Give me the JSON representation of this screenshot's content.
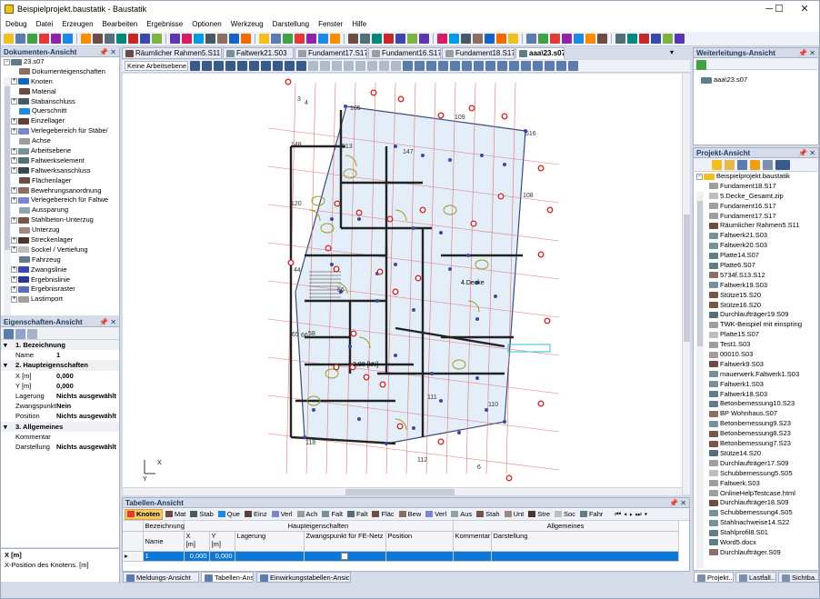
{
  "window": {
    "title": "Beispielprojekt.baustatik - Baustatik",
    "controls": [
      "─",
      "☐",
      "✕"
    ]
  },
  "menu": [
    "Debug",
    "Datei",
    "Erzeugen",
    "Bearbeiten",
    "Ergebnisse",
    "Optionen",
    "Werkzeug",
    "Darstellung",
    "Fenster",
    "Hilfe"
  ],
  "doc_panel": {
    "title": "Dokumenten-Ansicht",
    "root": "23.s07",
    "items": [
      {
        "label": "Dokumenteigenschaften",
        "expand": false,
        "color": "#8d6e63"
      },
      {
        "label": "Knoten",
        "expand": true,
        "color": "#1565c0"
      },
      {
        "label": "Material",
        "expand": false,
        "color": "#6d4c41"
      },
      {
        "label": "Stabanschluss",
        "expand": true,
        "color": "#455a64"
      },
      {
        "label": "Querschnitt",
        "expand": false,
        "color": "#1e88e5"
      },
      {
        "label": "Einzellager",
        "expand": true,
        "color": "#5d4037"
      },
      {
        "label": "Verlegebereich für Stäbe/",
        "expand": true,
        "color": "#7986cb"
      },
      {
        "label": "Achse",
        "expand": false,
        "color": "#9e9e9e"
      },
      {
        "label": "Arbeitsebene",
        "expand": true,
        "color": "#78909c"
      },
      {
        "label": "Faltwerkselement",
        "expand": true,
        "color": "#546e7a"
      },
      {
        "label": "Faltwerksanschluss",
        "expand": true,
        "color": "#37474f"
      },
      {
        "label": "Flächenlager",
        "expand": false,
        "color": "#6d4c41"
      },
      {
        "label": "Bewehrungsanordnung",
        "expand": true,
        "color": "#8d6e63"
      },
      {
        "label": "Verlegebereich für Faltwe",
        "expand": true,
        "color": "#7986cb"
      },
      {
        "label": "Aussparung",
        "expand": false,
        "color": "#90a4ae"
      },
      {
        "label": "Stahlbeton-Unterzug",
        "expand": true,
        "color": "#795548"
      },
      {
        "label": "Unterzug",
        "expand": false,
        "color": "#a1887f"
      },
      {
        "label": "Streckenlager",
        "expand": true,
        "color": "#4e342e"
      },
      {
        "label": "Sockel / Vertiefung",
        "expand": true,
        "color": "#bdbdbd"
      },
      {
        "label": "Fahrzeug",
        "expand": false,
        "color": "#607d8b"
      },
      {
        "label": "Zwangslinie",
        "expand": true,
        "color": "#3949ab"
      },
      {
        "label": "Ergebnislinie",
        "expand": true,
        "color": "#283593"
      },
      {
        "label": "Ergebnisraster",
        "expand": true,
        "color": "#5c6bc0"
      },
      {
        "label": "Lastimport",
        "expand": true,
        "color": "#9e9e9e"
      }
    ]
  },
  "props_panel": {
    "title": "Eigenschaften-Ansicht",
    "rows": [
      {
        "type": "cat",
        "k": "1. Bezeichnung",
        "v": ""
      },
      {
        "type": "row",
        "k": "Name",
        "v": "1"
      },
      {
        "type": "cat",
        "k": "2. Haupteigenschaften",
        "v": ""
      },
      {
        "type": "row",
        "k": "X [m]",
        "v": "0,000"
      },
      {
        "type": "row",
        "k": "Y [m]",
        "v": "0,000"
      },
      {
        "type": "row",
        "k": "Lagerung",
        "v": "Nichts ausgewählt"
      },
      {
        "type": "row",
        "k": "Zwangspunkt",
        "v": "Nein"
      },
      {
        "type": "row",
        "k": "Position",
        "v": "Nichts ausgewählt"
      },
      {
        "type": "cat",
        "k": "3. Allgemeines",
        "v": ""
      },
      {
        "type": "row",
        "k": "Kommentar",
        "v": ""
      },
      {
        "type": "row",
        "k": "Darstellung",
        "v": "Nichts ausgewählt"
      }
    ],
    "help_title": "X [m]",
    "help_text": "X-Position des Knotens. [m]"
  },
  "tabs": [
    {
      "label": "Räumlicher Rahmen5.S11",
      "color": "#6d4c41",
      "active": false
    },
    {
      "label": "Faltwerk21.S03",
      "color": "#78909c",
      "active": false
    },
    {
      "label": "Fundament17.S17",
      "color": "#9e9e9e",
      "active": false
    },
    {
      "label": "Fundament16.S17",
      "color": "#9e9e9e",
      "active": false
    },
    {
      "label": "Fundament18.S17",
      "color": "#9e9e9e",
      "active": false
    },
    {
      "label": "aaa\\23.s07",
      "color": "#607d8b",
      "active": true
    }
  ],
  "canvas_toolbar": {
    "workplane": "Keine Arbeitsebene"
  },
  "drawing": {
    "node_labels": [
      "4",
      "3",
      "105",
      "516",
      "148",
      "513",
      "147",
      "108",
      "109",
      "120",
      "44",
      "4.Decke",
      "56",
      "58",
      "66",
      "65",
      "2,98 [kN]",
      "111",
      "110",
      "118",
      "112",
      "6"
    ],
    "axis_x": "X",
    "axis_y": "Y"
  },
  "forward_panel": {
    "title": "Weiterleitungs-Ansicht",
    "item": "aaa\\23.s07"
  },
  "project_panel": {
    "title": "Projekt-Ansicht",
    "root": "Beispielprojekt.baustatik",
    "items": [
      "Fundament18.S17",
      "5.Decke_Gesamt.zip",
      "Fundament16.S17",
      "Fundament17.S17",
      "Räumlicher Rahmen5.S11",
      "Faltwerk21.S03",
      "Faltwerk20.S03",
      "Platte14.S07",
      "Platte6.S07",
      "5734f.S13.S12",
      "Faltwerk19.S03",
      "Stütze15.S20",
      "Stütze16.S20",
      "Durchlaufträger19.S09",
      "TWK-Beispiel mit einspring",
      "Platte15.S07",
      "Test1.S03",
      "00010.S03",
      "Faltwerk9.S03",
      "mauerwerk.Faltwerk1.S03",
      "Faltwerk1.S03",
      "Faltwerk18.S03",
      "Betonbemessung10.S23",
      "BP Wohnhaus.S07",
      "Betonbemessung9.S23",
      "Betonbemessung8.S23",
      "Betonbemessung7.S23",
      "Stütze14.S20",
      "Durchlaufträger17.S09",
      "Schubbemessung5.S05",
      "Faltwerk.S03",
      "OnlineHelpTestcase.html",
      "Durchlaufträger18.S09",
      "Schubbemessung4.S05",
      "Stahlnachweise14.S22",
      "Stahlprofil8.S01",
      "Word5.docx",
      "Durchlaufträger.S09"
    ],
    "bottom_tabs": [
      "Projekt...",
      "Lastfall...",
      "Sichtba..."
    ]
  },
  "table_panel": {
    "title": "Tabellen-Ansicht",
    "tabs": [
      "Knoten",
      "Mat",
      "Stab",
      "Que",
      "Einz",
      "Verl",
      "Ach",
      "Falt",
      "Falt",
      "Fläc",
      "Bew",
      "Verl",
      "Aus",
      "Stah",
      "Unt",
      "Stre",
      "Soc",
      "Fahr"
    ],
    "group_headers": [
      "Bezeichnung",
      "Haupteigenschaften",
      "Allgemeines"
    ],
    "columns": [
      "Name",
      "X\n[m]",
      "Y\n[m]",
      "Lagerung",
      "Zwangspunkt für FE-Netz",
      "Position",
      "Kommentar",
      "Darstellung"
    ],
    "rows": [
      {
        "Name": "1",
        "X": "0,000",
        "Y": "0,000",
        "Lagerung": "",
        "Zwangspunkt": "",
        "Position": "",
        "Kommentar": "",
        "Darstellung": ""
      }
    ]
  },
  "status_tabs": [
    "Meldungs-Ansicht",
    "Tabellen-Ansicht",
    "Einwirkungstabellen-Ansicht"
  ]
}
